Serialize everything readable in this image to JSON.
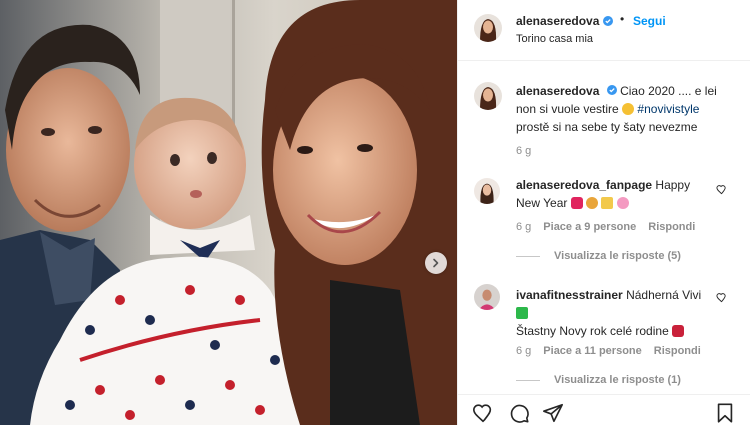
{
  "post": {
    "username": "alenaseredova",
    "dot": "•",
    "follow_label": "Segui",
    "location": "Torino casa mia",
    "caption_user": "alenaseredova",
    "caption_text_1": "Ciao 2020 .... e lei non si vuole vestire",
    "hashtag": "#novivistyle",
    "caption_text_2": "prostě si na sebe ty šaty nevezme",
    "age": "6 g"
  },
  "comments": [
    {
      "username": "alenaseredova_fanpage",
      "text": "Happy New Year",
      "age": "6 g",
      "likes": "Piace a 9 persone",
      "reply_label": "Rispondi",
      "view_replies": "Visualizza le risposte (5)"
    },
    {
      "username": "ivanafitnesstrainer",
      "text": "Nádherná Vivi",
      "text_2": "Štastny Novy rok celé rodine",
      "age": "6 g",
      "likes": "Piace a 11 persone",
      "reply_label": "Rispondi",
      "view_replies": "Visualizza le risposte (1)"
    }
  ],
  "icons": {
    "like": "heart-icon",
    "comment": "comment-icon",
    "share": "share-icon",
    "save": "bookmark-icon",
    "next": "chevron-right-icon",
    "verified": "verified-badge-icon"
  },
  "colors": {
    "link_blue": "#0095f6",
    "hashtag": "#00376b",
    "muted": "#8e8e8e",
    "verified": "#3897f0"
  }
}
